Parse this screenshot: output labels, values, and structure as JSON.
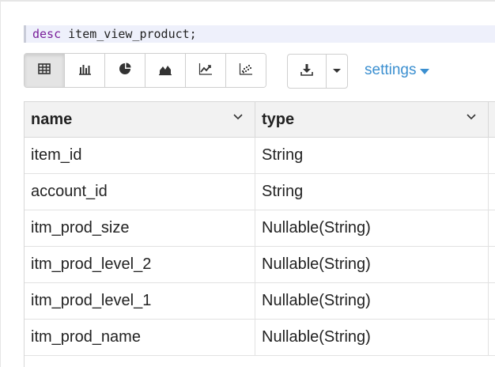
{
  "query": {
    "keyword": "desc",
    "rest": " item_view_product;"
  },
  "toolbar": {
    "viz_buttons": [
      {
        "name": "table-view-button",
        "icon": "table-icon",
        "active": true
      },
      {
        "name": "bar-chart-button",
        "icon": "bar-chart-icon",
        "active": false
      },
      {
        "name": "pie-chart-button",
        "icon": "pie-chart-icon",
        "active": false
      },
      {
        "name": "area-chart-button",
        "icon": "area-chart-icon",
        "active": false
      },
      {
        "name": "line-chart-button",
        "icon": "line-chart-icon",
        "active": false
      },
      {
        "name": "scatter-chart-button",
        "icon": "scatter-chart-icon",
        "active": false
      }
    ],
    "settings_label": "settings"
  },
  "table": {
    "columns": [
      "name",
      "type"
    ],
    "rows": [
      [
        "item_id",
        "String"
      ],
      [
        "account_id",
        "String"
      ],
      [
        "itm_prod_size",
        "Nullable(String)"
      ],
      [
        "itm_prod_level_2",
        "Nullable(String)"
      ],
      [
        "itm_prod_level_1",
        "Nullable(String)"
      ],
      [
        "itm_prod_name",
        "Nullable(String)"
      ]
    ]
  },
  "colors": {
    "link": "#3b8fd0",
    "keyword": "#7a1f9a",
    "query_bg": "#eef0fb",
    "header_bg": "#f2f2f2"
  }
}
